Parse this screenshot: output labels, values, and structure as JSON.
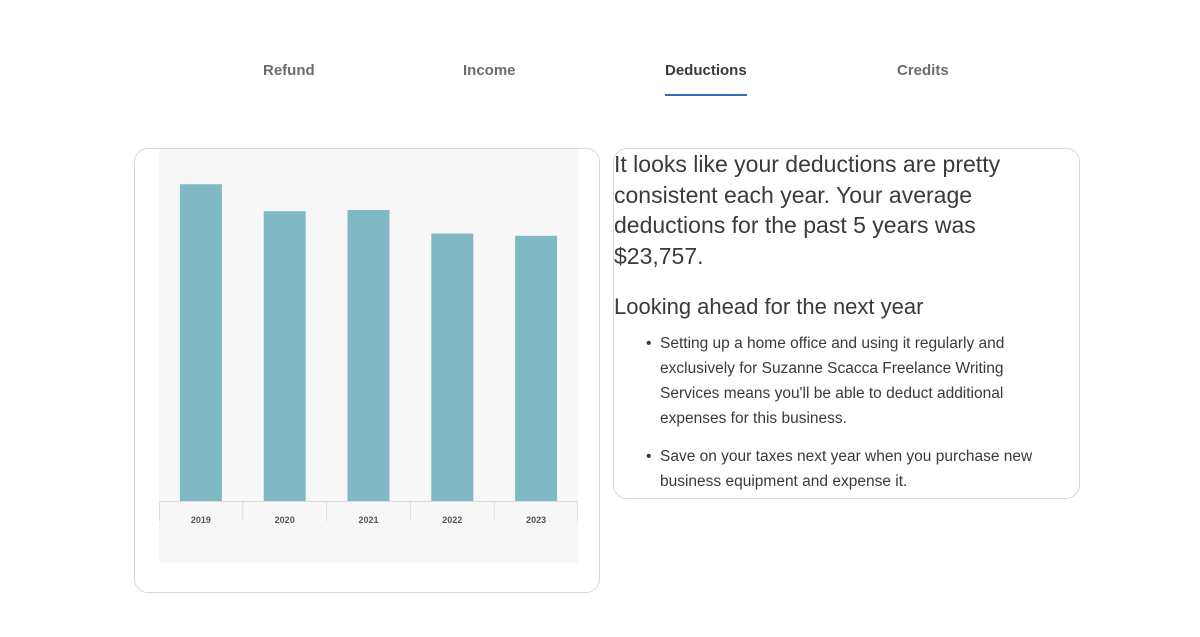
{
  "tabs": [
    {
      "label": "Refund",
      "active": false
    },
    {
      "label": "Income",
      "active": false
    },
    {
      "label": "Deductions",
      "active": true
    },
    {
      "label": "Credits",
      "active": false
    }
  ],
  "chart_data": {
    "type": "bar",
    "categories": [
      "2019",
      "2020",
      "2021",
      "2022",
      "2023"
    ],
    "values": [
      27000,
      24700,
      24800,
      22800,
      22600
    ],
    "ylim": [
      0,
      30000
    ],
    "bar_color": "#80b9c5",
    "background_color": "#f7f7f7",
    "grid": false,
    "legend": "none"
  },
  "summary": {
    "text": "It looks like your deductions are pretty consistent each year. Your average deductions for the past 5 years was $23,757."
  },
  "ahead": {
    "heading": "Looking ahead for the next year",
    "tips": [
      "Setting up a home office and using it regularly and exclusively for Suzanne Scacca Freelance Writing Services means you'll be able to deduct additional expenses for this business.",
      "Save on your taxes next year when you purchase new business equipment and expense it."
    ]
  }
}
